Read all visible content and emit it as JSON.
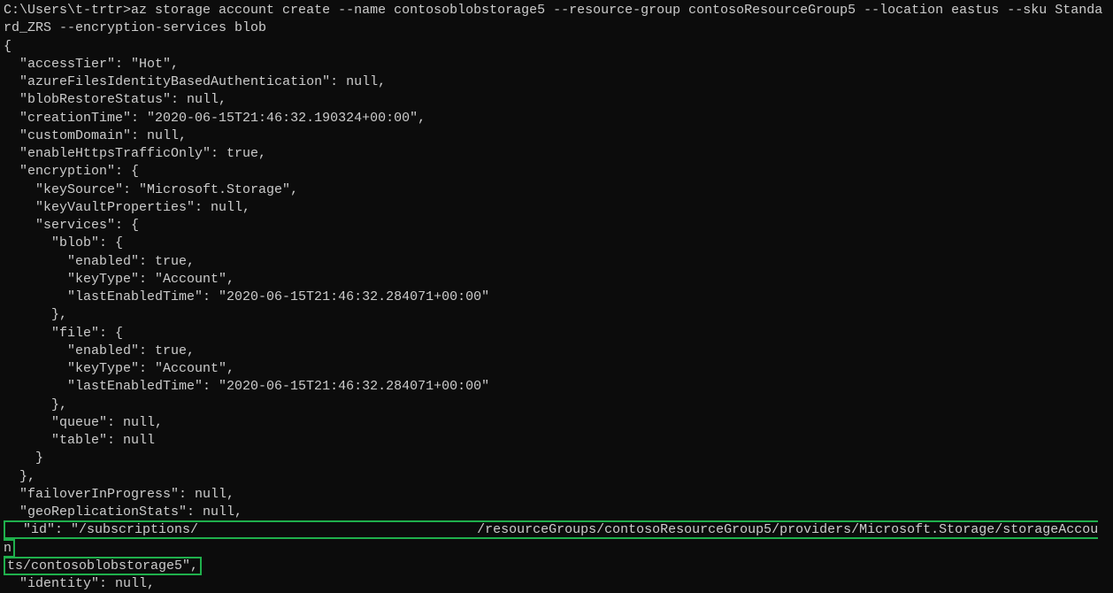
{
  "terminal": {
    "prompt": "C:\\Users\\t-trtr>",
    "command": "az storage account create --name contosoblobstorage5 --resource-group contosoResourceGroup5 --location eastus --sku Standard_ZRS --encryption-services blob",
    "output": {
      "line_open": "{",
      "accessTier": "  \"accessTier\": \"Hot\",",
      "azureFiles": "  \"azureFilesIdentityBasedAuthentication\": null,",
      "blobRestore": "  \"blobRestoreStatus\": null,",
      "creationTime": "  \"creationTime\": \"2020-06-15T21:46:32.190324+00:00\",",
      "customDomain": "  \"customDomain\": null,",
      "enableHttps": "  \"enableHttpsTrafficOnly\": true,",
      "encryption_open": "  \"encryption\": {",
      "keySource": "    \"keySource\": \"Microsoft.Storage\",",
      "keyVault": "    \"keyVaultProperties\": null,",
      "services_open": "    \"services\": {",
      "blob_open": "      \"blob\": {",
      "blob_enabled": "        \"enabled\": true,",
      "blob_keyType": "        \"keyType\": \"Account\",",
      "blob_lastEnabled": "        \"lastEnabledTime\": \"2020-06-15T21:46:32.284071+00:00\"",
      "blob_close": "      },",
      "file_open": "      \"file\": {",
      "file_enabled": "        \"enabled\": true,",
      "file_keyType": "        \"keyType\": \"Account\",",
      "file_lastEnabled": "        \"lastEnabledTime\": \"2020-06-15T21:46:32.284071+00:00\"",
      "file_close": "      },",
      "queue": "      \"queue\": null,",
      "table": "      \"table\": null",
      "services_close": "    }",
      "encryption_close": "  },",
      "failover": "  \"failoverInProgress\": null,",
      "geoRepl": "  \"geoReplicationStats\": null,",
      "id_line1": "  \"id\": \"/subscriptions/                                   /resourceGroups/contosoResourceGroup5/providers/Microsoft.Storage/storageAccoun",
      "id_line2": "ts/contosoblobstorage5\",",
      "identity": "  \"identity\": null,"
    }
  }
}
